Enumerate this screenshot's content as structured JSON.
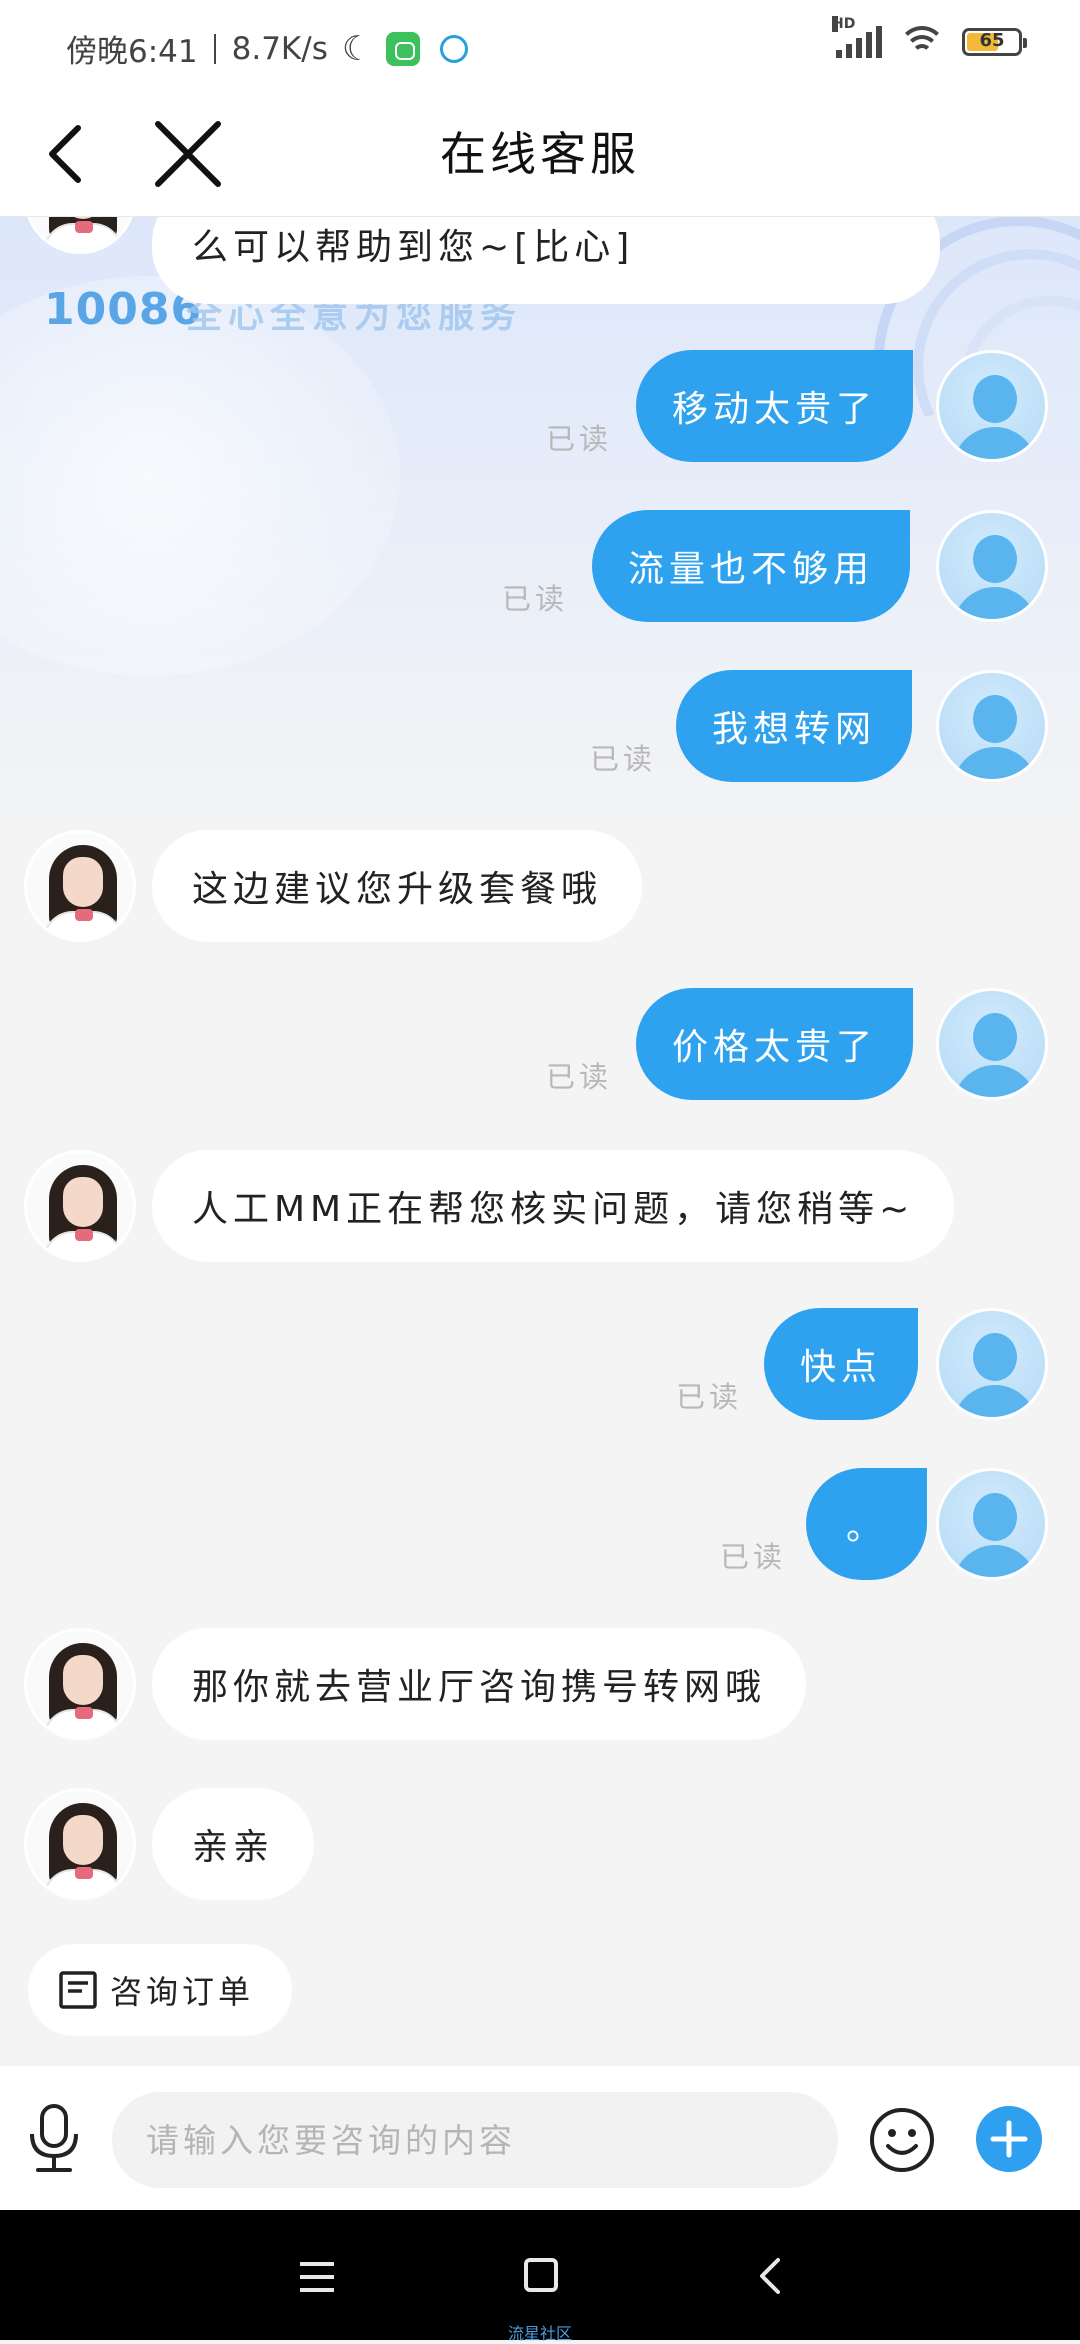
{
  "status_bar": {
    "time": "傍晚6:41",
    "net_speed": "8.7K/s",
    "signal_label": "HD",
    "battery": "65",
    "battery_level": 0.65
  },
  "header": {
    "title": "在线客服",
    "back_icon": "chevron-left-icon",
    "close_icon": "close-icon"
  },
  "banner": {
    "brand_number": "10086",
    "slogan": "全心全意为您服务"
  },
  "messages": [
    {
      "from": "agent",
      "text": "么可以帮助到您~[比心]"
    },
    {
      "from": "user",
      "text": "移动太贵了",
      "status": "已读"
    },
    {
      "from": "user",
      "text": "流量也不够用",
      "status": "已读"
    },
    {
      "from": "user",
      "text": "我想转网",
      "status": "已读"
    },
    {
      "from": "agent",
      "text": "这边建议您升级套餐哦"
    },
    {
      "from": "user",
      "text": "价格太贵了",
      "status": "已读"
    },
    {
      "from": "agent",
      "text": "人工MM正在帮您核实问题，请您稍等~"
    },
    {
      "from": "user",
      "text": "快点",
      "status": "已读"
    },
    {
      "from": "user",
      "text": "。",
      "status": "已读"
    },
    {
      "from": "agent",
      "text": "那你就去营业厅咨询携号转网哦"
    },
    {
      "from": "agent",
      "text": "亲亲"
    }
  ],
  "quick_action": {
    "label": "咨询订单",
    "icon": "order-list-icon"
  },
  "input_bar": {
    "placeholder": "请输入您要咨询的内容",
    "mic_icon": "microphone-icon",
    "emoji_icon": "emoji-icon",
    "plus_icon": "plus-icon"
  },
  "system_nav": {
    "watermark": "流星社区"
  },
  "colors": {
    "user_bubble": "#2ea2ef",
    "agent_bubble": "#ffffff",
    "read_status": "#b8b8b8",
    "brand_blue": "#59a5e6"
  }
}
